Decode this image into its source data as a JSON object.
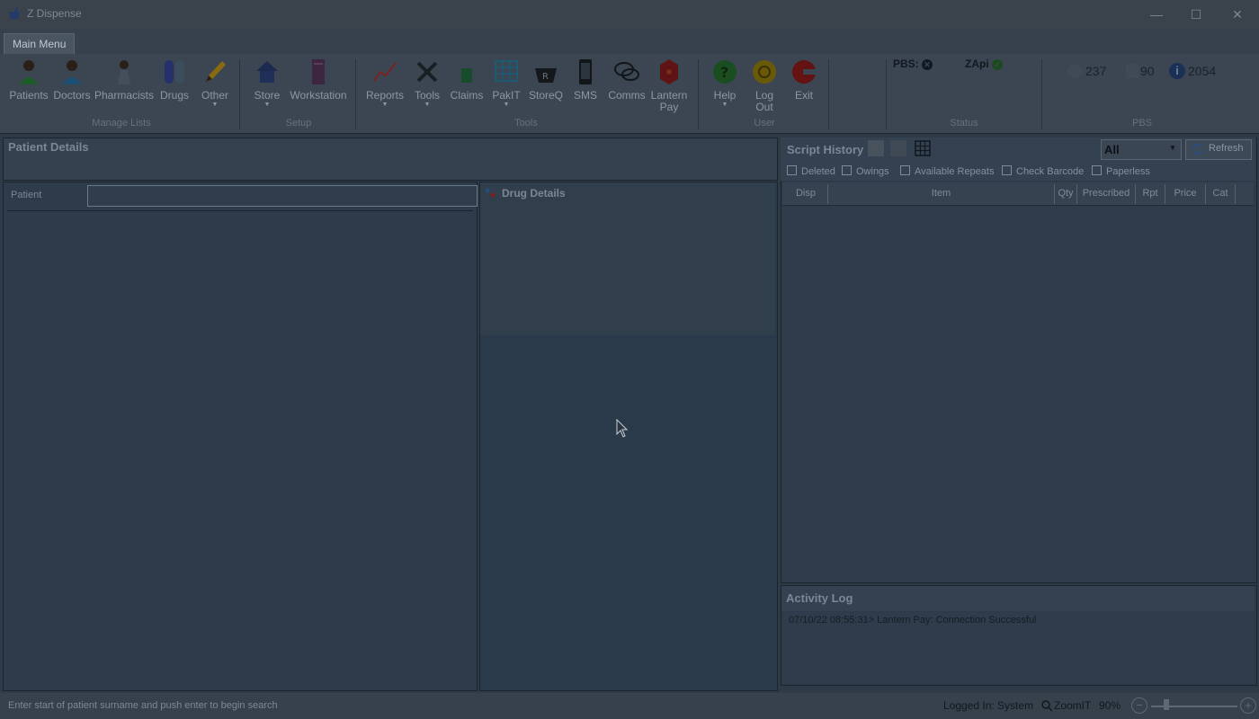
{
  "window": {
    "title": "Z Dispense",
    "minimize_glyph": "—",
    "maximize_glyph": "☐",
    "close_glyph": "✕"
  },
  "ribbon": {
    "tab": "Main Menu",
    "groups": {
      "manage_lists": "Manage Lists",
      "setup": "Setup",
      "tools": "Tools",
      "user": "User",
      "status": "Status",
      "pbs": "PBS"
    },
    "buttons": {
      "patients": "Patients",
      "doctors": "Doctors",
      "pharmacists": "Pharmacists",
      "drugs": "Drugs",
      "other": "Other",
      "store": "Store",
      "workstation": "Workstation",
      "reports": "Reports",
      "tools": "Tools",
      "claims": "Claims",
      "pakit": "PakIT",
      "storeq": "StoreQ",
      "sms": "SMS",
      "comms": "Comms",
      "lantern_pay_1": "Lantern",
      "lantern_pay_2": "Pay",
      "help": "Help",
      "logout_1": "Log",
      "logout_2": "Out",
      "exit": "Exit"
    },
    "status": {
      "pbs_label": "PBS:",
      "zapi_label": "ZApi"
    },
    "pbs_counts": {
      "a": "237",
      "b": "90",
      "c": "2054"
    }
  },
  "patient": {
    "section_title": "Patient Details",
    "field_label": "Patient",
    "field_value": ""
  },
  "drug": {
    "section_title": "Drug Details"
  },
  "script_history": {
    "title": "Script History",
    "filter_value": "All",
    "refresh_label": "Refresh",
    "checkboxes": [
      "Deleted",
      "Owings",
      "Available Repeats",
      "Check Barcode",
      "Paperless"
    ],
    "columns": [
      "Disp",
      "Item",
      "Qty",
      "Prescribed",
      "Rpt",
      "Price",
      "Cat"
    ]
  },
  "activity_log": {
    "title": "Activity Log",
    "entries": [
      "07/10/22 08:55:31> Lantern Pay: Connection Successful"
    ]
  },
  "statusbar": {
    "hint": "Enter start of patient surname and push enter to begin search",
    "logged_in": "Logged In: System",
    "zoomit": "ZoomIT",
    "zoom_level": "90%",
    "zoom_level_fraction": 0.9,
    "zoom_minus": "−",
    "zoom_plus": "+"
  },
  "colors": {
    "accent_green": "#2f7a2f",
    "accent_red": "#9a1616",
    "accent_yellow": "#b8a200"
  }
}
